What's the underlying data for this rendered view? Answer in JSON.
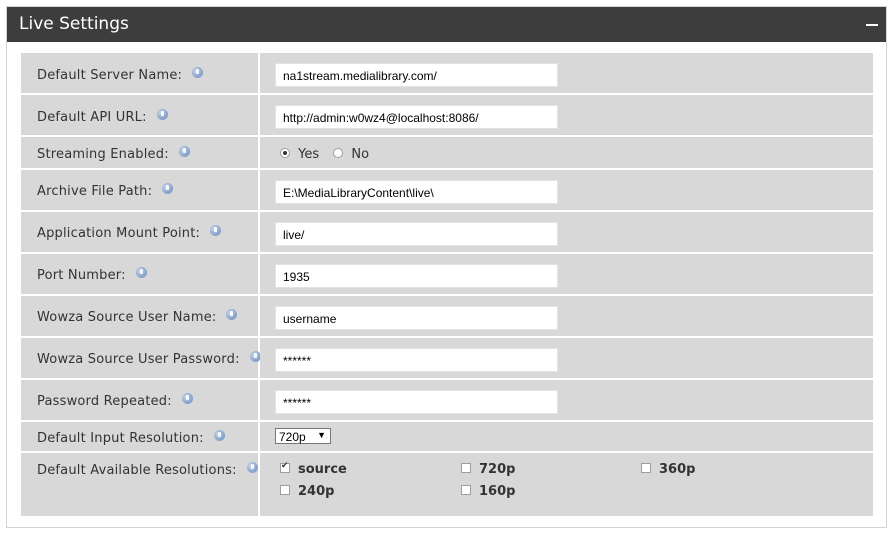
{
  "panel": {
    "title": "Live Settings",
    "collapse_icon": "minus-icon"
  },
  "fields": {
    "server_name": {
      "label": "Default Server Name:",
      "value": "na1stream.medialibrary.com/"
    },
    "api_url": {
      "label": "Default API URL:",
      "value": "http://admin:w0wz4@localhost:8086/"
    },
    "streaming": {
      "label": "Streaming Enabled:",
      "yes": "Yes",
      "no": "No",
      "selected": "Yes"
    },
    "archive_path": {
      "label": "Archive File Path:",
      "value": "E:\\MediaLibraryContent\\live\\"
    },
    "mount_point": {
      "label": "Application Mount Point:",
      "value": "live/"
    },
    "port": {
      "label": "Port Number:",
      "value": "1935"
    },
    "wowza_user": {
      "label": "Wowza Source User Name:",
      "value": "username"
    },
    "wowza_password": {
      "label": "Wowza Source User Password:",
      "value": "******"
    },
    "password_repeated": {
      "label": "Password Repeated:",
      "value": "******"
    },
    "input_resolution": {
      "label": "Default Input Resolution:",
      "value": "720p"
    },
    "available_resolutions": {
      "label": "Default Available Resolutions:",
      "options": [
        {
          "label": "source",
          "checked": true
        },
        {
          "label": "720p",
          "checked": false
        },
        {
          "label": "360p",
          "checked": false
        },
        {
          "label": "240p",
          "checked": false
        },
        {
          "label": "160p",
          "checked": false
        }
      ]
    }
  },
  "colors": {
    "header": "#3d3d3d",
    "cell": "#d8d8d8",
    "help_icon": "#8ea8cf"
  }
}
